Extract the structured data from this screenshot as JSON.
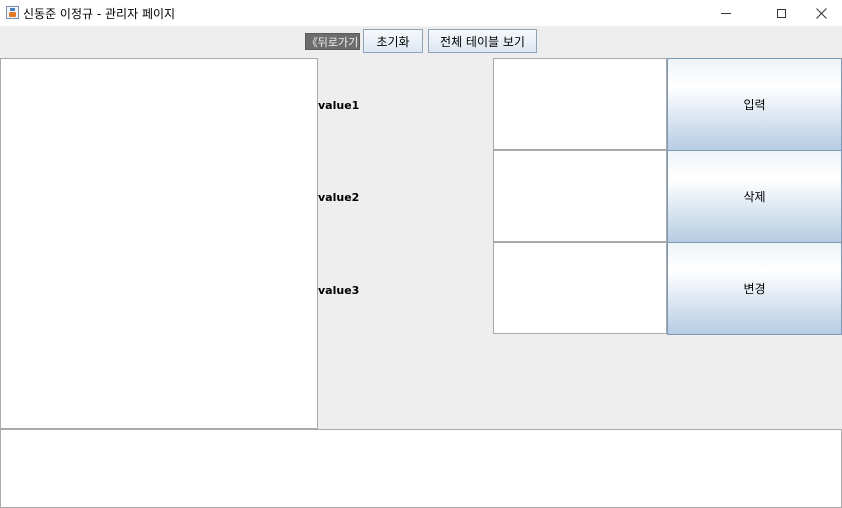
{
  "window": {
    "title": "신동준 이정규 - 관리자 페이지",
    "icon": "java-cup-icon"
  },
  "toolbar": {
    "back_label": "《뒤로가기",
    "reset_label": "초기화",
    "view_all_label": "전체 테이블 보기"
  },
  "fields": [
    {
      "label": "value1",
      "value": ""
    },
    {
      "label": "value2",
      "value": ""
    },
    {
      "label": "value3",
      "value": ""
    }
  ],
  "actions": {
    "insert_label": "입력",
    "delete_label": "삭제",
    "update_label": "변경"
  },
  "output": {
    "left_text": "",
    "bottom_text": ""
  }
}
